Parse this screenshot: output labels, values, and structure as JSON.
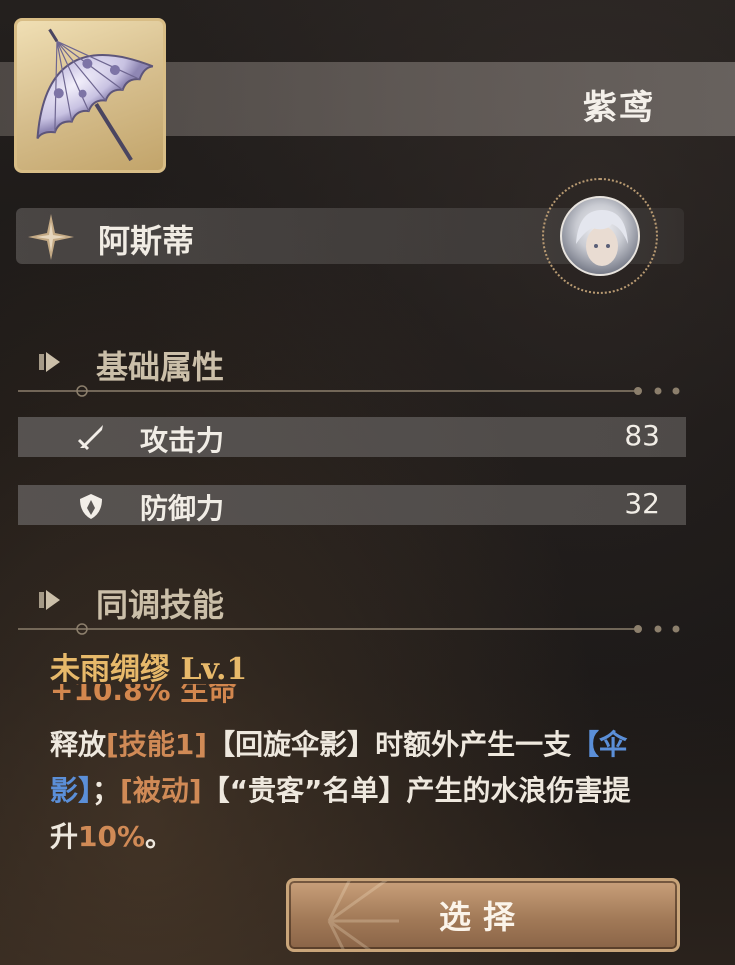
{
  "weapon": {
    "name": "紫鸢",
    "icon": "umbrella-icon"
  },
  "character": {
    "name": "阿斯蒂",
    "emblem_icon": "compass-star-icon",
    "avatar_icon": "character-avatar"
  },
  "base_attributes": {
    "title": "基础属性",
    "stats": [
      {
        "icon": "sword-icon",
        "label": "攻击力",
        "value": "83"
      },
      {
        "icon": "shield-icon",
        "label": "防御力",
        "value": "32"
      }
    ]
  },
  "sync_skill": {
    "title": "同调技能",
    "name": "未雨绸缪",
    "level": "Lv.1",
    "extra_line": "+10.8% 生命",
    "description": {
      "p1": "释放",
      "p2": "[技能1]",
      "p3": "【回旋伞影】时额外产生一支",
      "p4": "【伞影】",
      "p5": "；",
      "p6": "[被动]",
      "p7": "【“贵客”名单】产生的水浪伤害提升",
      "p8": "10%",
      "p9": "。"
    }
  },
  "actions": {
    "select_label": "选择"
  },
  "colors": {
    "accent_gold": "#e7b96a",
    "highlight_orange": "#d08a56",
    "highlight_blue": "#5b8fd8"
  }
}
